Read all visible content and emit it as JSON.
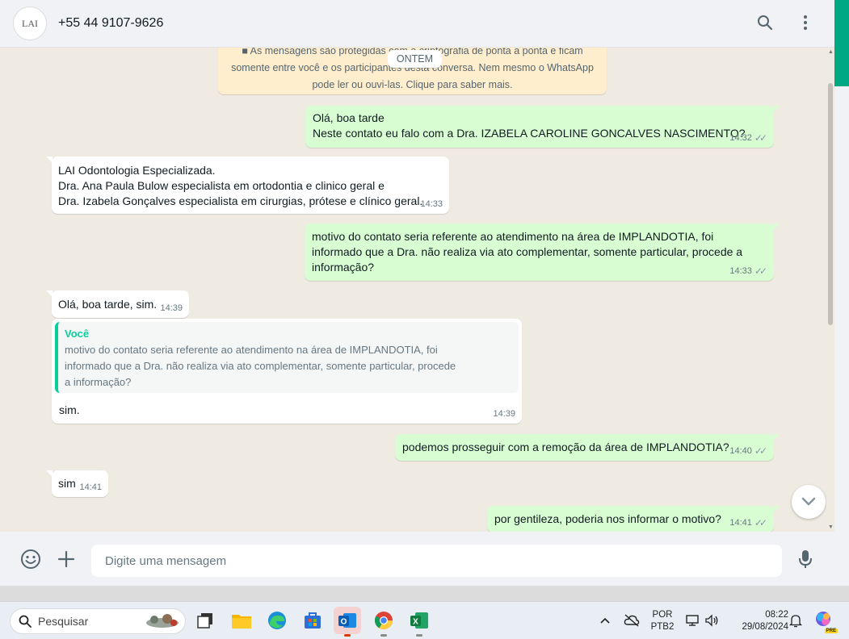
{
  "header": {
    "avatar_text": "LAI",
    "contact_name": "+55 44 9107-9626",
    "search_icon": "search-icon",
    "menu_icon": "kebab-menu-icon"
  },
  "chat": {
    "encryption_notice": {
      "line1": "■ As mensagens são protegidas com a criptografia de ponta a ponta e ficam",
      "line2": "somente entre você e os participantes desta conversa. Nem mesmo o WhatsApp",
      "line3": "pode ler ou ouvi-las. Clique para saber mais."
    },
    "date_chip": "ONTEM",
    "messages": [
      {
        "dir": "out",
        "text": "Olá, boa tarde\nNeste contato eu falo com a Dra. IZABELA CAROLINE GONCALVES NASCIMENTO?",
        "time": "14:32"
      },
      {
        "dir": "in",
        "text": "LAI Odontologia Especializada.\nDra. Ana Paula Bulow especialista em ortodontia e clinico geral e\nDra. Izabela Gonçalves especialista em cirurgias, prótese e clínico geral.",
        "time": "14:33"
      },
      {
        "dir": "out",
        "text": "motivo do contato seria referente ao atendimento na área de IMPLANDOTIA, foi\ninformado que a Dra. não realiza via ato complementar, somente particular, procede a\ninformação?",
        "time": "14:33"
      },
      {
        "dir": "in",
        "text": "Olá, boa tarde, sim.",
        "time": "14:39"
      },
      {
        "dir": "in",
        "quote_author": "Você",
        "quote_text": "motivo do contato seria referente ao atendimento na área de IMPLANDOTIA, foi\ninformado que a Dra. não realiza via ato complementar, somente particular, procede\na informação?",
        "text": "sim.",
        "time": "14:39"
      },
      {
        "dir": "out",
        "text": "podemos prosseguir com a remoção da área de IMPLANDOTIA?",
        "time": "14:40"
      },
      {
        "dir": "in",
        "text": "sim",
        "time": "14:41"
      },
      {
        "dir": "out",
        "text": "por gentileza, poderia nos informar o motivo?",
        "time": "14:41"
      }
    ],
    "read_ticks": "✓✓"
  },
  "composer": {
    "emoji_icon": "emoji-icon",
    "attach_icon": "plus-icon",
    "placeholder": "Digite uma mensagem",
    "mic_icon": "microphone-icon"
  },
  "taskbar": {
    "search_label": "Pesquisar",
    "language_line1": "POR",
    "language_line2": "PTB2",
    "time": "08:22",
    "date": "29/08/2024",
    "copilot_badge": "PRE"
  },
  "colors": {
    "accent": "#00a884",
    "outgoing_bubble": "#d9fdd3",
    "incoming_bubble": "#ffffff",
    "notice_bg": "#ffeecd",
    "chat_bg": "#efeae2"
  }
}
